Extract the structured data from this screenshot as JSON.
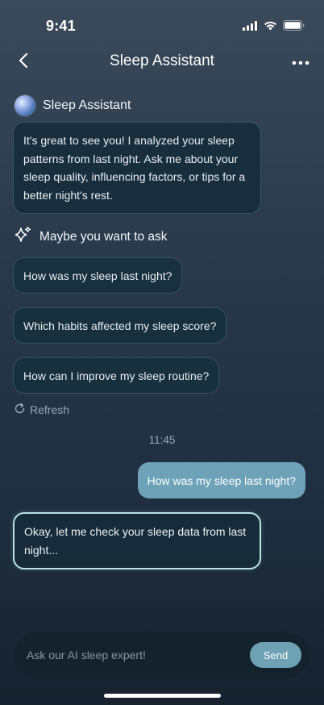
{
  "status_bar": {
    "time": "9:41"
  },
  "header": {
    "title": "Sleep Assistant"
  },
  "assistant": {
    "name": "Sleep Assistant"
  },
  "intro_message": "It's great to see you! I analyzed your sleep patterns from last night. Ask me about your sleep quality, influencing factors, or tips for a better night's rest.",
  "suggestions": {
    "title": "Maybe you want to ask",
    "items": [
      "How was my sleep last night?",
      "Which habits affected my sleep score?",
      "How can I improve my sleep routine?"
    ],
    "refresh_label": "Refresh"
  },
  "conversation": {
    "timestamp": "11:45",
    "user_message": "How was my sleep last night?",
    "assistant_reply": "Okay, let me check your sleep data from last night..."
  },
  "input": {
    "placeholder": "Ask our AI sleep expert!",
    "value": "",
    "send_label": "Send"
  },
  "colors": {
    "accent": "#6da2b8",
    "reply_border": "#b8e2e2"
  }
}
